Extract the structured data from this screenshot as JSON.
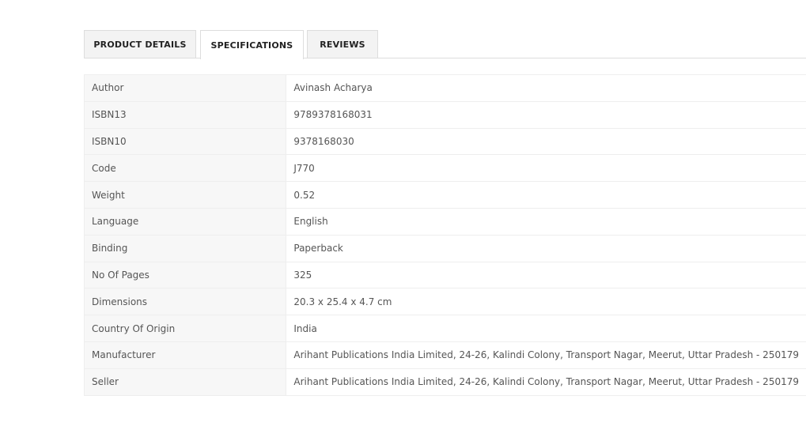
{
  "tabs": [
    {
      "label": "PRODUCT DETAILS",
      "active": false
    },
    {
      "label": "SPECIFICATIONS",
      "active": true
    },
    {
      "label": "REVIEWS",
      "active": false
    }
  ],
  "specs": [
    {
      "key": "Author",
      "value": "Avinash Acharya"
    },
    {
      "key": "ISBN13",
      "value": "9789378168031"
    },
    {
      "key": "ISBN10",
      "value": "9378168030"
    },
    {
      "key": "Code",
      "value": "J770"
    },
    {
      "key": "Weight",
      "value": "0.52"
    },
    {
      "key": "Language",
      "value": "English"
    },
    {
      "key": "Binding",
      "value": "Paperback"
    },
    {
      "key": "No Of Pages",
      "value": "325"
    },
    {
      "key": "Dimensions",
      "value": "20.3 x 25.4 x 4.7 cm"
    },
    {
      "key": "Country Of Origin",
      "value": "India"
    },
    {
      "key": "Manufacturer",
      "value": "Arihant Publications India Limited, 24-26, Kalindi Colony, Transport Nagar, Meerut, Uttar Pradesh - 250179"
    },
    {
      "key": "Seller",
      "value": "Arihant Publications India Limited, 24-26, Kalindi Colony, Transport Nagar, Meerut, Uttar Pradesh - 250179"
    }
  ]
}
